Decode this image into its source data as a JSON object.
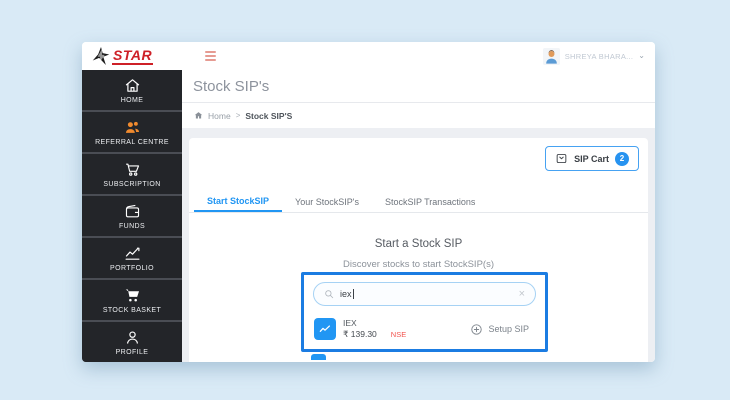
{
  "brand": {
    "logo_text": "STAR"
  },
  "topbar": {
    "user_name": "SHREYA BHARA...",
    "chevron": "⌄"
  },
  "sidebar": {
    "items": [
      {
        "label": "HOME",
        "icon": "home-icon"
      },
      {
        "label": "REFERRAL CENTRE",
        "icon": "people-icon"
      },
      {
        "label": "SUBSCRIPTION",
        "icon": "cart-outline-icon"
      },
      {
        "label": "FUNDS",
        "icon": "wallet-icon"
      },
      {
        "label": "PORTFOLIO",
        "icon": "chart-line-icon"
      },
      {
        "label": "STOCK BASKET",
        "icon": "cart-filled-icon"
      },
      {
        "label": "PROFILE",
        "icon": "person-icon"
      }
    ]
  },
  "page": {
    "title": "Stock SIP's",
    "breadcrumb": {
      "home": "Home",
      "separator": ">",
      "current": "Stock SIP'S"
    }
  },
  "sip_cart": {
    "label": "SIP Cart",
    "count": "2"
  },
  "tabs": [
    {
      "label": "Start StockSIP",
      "active": true
    },
    {
      "label": "Your StockSIP's",
      "active": false
    },
    {
      "label": "StockSIP Transactions",
      "active": false
    }
  ],
  "content": {
    "heading": "Start a Stock SIP",
    "subheading": "Discover stocks to start StockSIP(s)",
    "search": {
      "value": "iex",
      "clear": "×"
    },
    "results": [
      {
        "symbol": "IEX",
        "price": "₹ 139.30",
        "exchange": "NSE",
        "action": "Setup SIP"
      }
    ]
  },
  "colors": {
    "accent_blue": "#2196f3",
    "highlight_border": "#1b7ce2",
    "brand_red": "#ce2027",
    "referral_orange": "#f08a2e",
    "exchange_red": "#f2534e",
    "sidebar_dark": "#232529",
    "page_background": "#d9eaf6"
  }
}
